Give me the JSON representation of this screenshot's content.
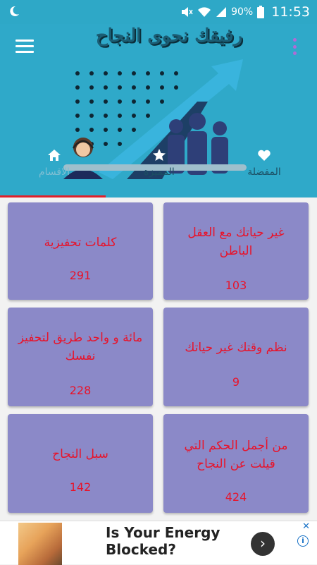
{
  "status": {
    "battery": "90%",
    "time": "11:53"
  },
  "header": {
    "banner_title": "رفيقك نحوى النجاح"
  },
  "tabs": [
    {
      "label": "الاقسام",
      "icon": "home-icon"
    },
    {
      "label": "المميزة",
      "icon": "star-icon"
    },
    {
      "label": "المفضلة",
      "icon": "heart-icon"
    }
  ],
  "cards": [
    {
      "title": "غير حياتك مع العقل الباطن",
      "count": "103"
    },
    {
      "title": "كلمات تحفيزية",
      "count": "291"
    },
    {
      "title": "نظم وقتك غير حياتك",
      "count": "9"
    },
    {
      "title": "مائة و واحد طريق لتحفيز نفسك",
      "count": "228"
    },
    {
      "title": "من أجمل الحكم التي قيلت عن النجاح",
      "count": "424"
    },
    {
      "title": "سبل النجاح",
      "count": "142"
    }
  ],
  "ad": {
    "headline": "Is Your Energy Blocked?",
    "arrow": "›",
    "info": "i",
    "close": "✕"
  },
  "colors": {
    "header": "#2fa9c9",
    "card": "#8b89c8",
    "card_text": "#e8132a",
    "tab_indicator": "#e0202a"
  }
}
